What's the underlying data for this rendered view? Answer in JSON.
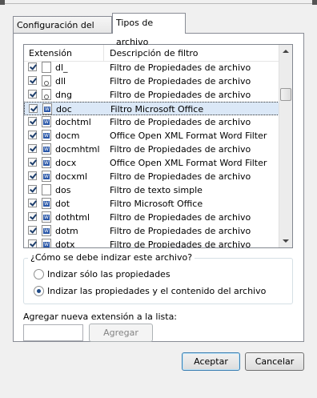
{
  "tabs": [
    {
      "label": "Configuración del índice"
    },
    {
      "label": "Tipos de archivo"
    }
  ],
  "list": {
    "col_extension": "Extensión",
    "col_description": "Descripción de filtro",
    "rows": [
      {
        "ext": "dl_",
        "desc": "Filtro de Propiedades de archivo",
        "icon": "blank-file-icon",
        "checked": true
      },
      {
        "ext": "dll",
        "desc": "Filtro de Propiedades de archivo",
        "icon": "gear-file-icon",
        "checked": true
      },
      {
        "ext": "dng",
        "desc": "Filtro de Propiedades de archivo",
        "icon": "image-file-icon",
        "checked": true
      },
      {
        "ext": "doc",
        "desc": "Filtro Microsoft Office",
        "icon": "word-file-icon",
        "checked": true,
        "selected": true
      },
      {
        "ext": "dochtml",
        "desc": "Filtro de Propiedades de archivo",
        "icon": "word-file-icon",
        "checked": true
      },
      {
        "ext": "docm",
        "desc": "Office Open XML Format Word Filter",
        "icon": "word-file-icon",
        "checked": true
      },
      {
        "ext": "docmhtml",
        "desc": "Filtro de Propiedades de archivo",
        "icon": "word-file-icon",
        "checked": true
      },
      {
        "ext": "docx",
        "desc": "Office Open XML Format Word Filter",
        "icon": "word-file-icon",
        "checked": true
      },
      {
        "ext": "docxml",
        "desc": "Filtro de Propiedades de archivo",
        "icon": "word-file-icon",
        "checked": true
      },
      {
        "ext": "dos",
        "desc": "Filtro de texto simple",
        "icon": "blank-file-icon",
        "checked": true
      },
      {
        "ext": "dot",
        "desc": "Filtro Microsoft Office",
        "icon": "word-file-icon",
        "checked": true
      },
      {
        "ext": "dothtml",
        "desc": "Filtro de Propiedades de archivo",
        "icon": "word-file-icon",
        "checked": true
      },
      {
        "ext": "dotm",
        "desc": "Filtro de Propiedades de archivo",
        "icon": "word-file-icon",
        "checked": true
      },
      {
        "ext": "dotx",
        "desc": "Filtro de Propiedades de archivo",
        "icon": "word-file-icon",
        "checked": true
      }
    ]
  },
  "index_group": {
    "legend": "¿Cómo se debe indizar este archivo?",
    "option_props": "Indizar sólo las propiedades",
    "option_props_and_content": "Indizar las propiedades y el contenido del archivo",
    "selected": "option_props_and_content"
  },
  "add_extension": {
    "label": "Agregar nueva extensión a la lista:",
    "value": "",
    "button": "Agregar"
  },
  "footer": {
    "ok": "Aceptar",
    "cancel": "Cancelar"
  },
  "colors": {
    "selection": "#dbe8f7",
    "default_button_border": "#3c7fb1"
  }
}
